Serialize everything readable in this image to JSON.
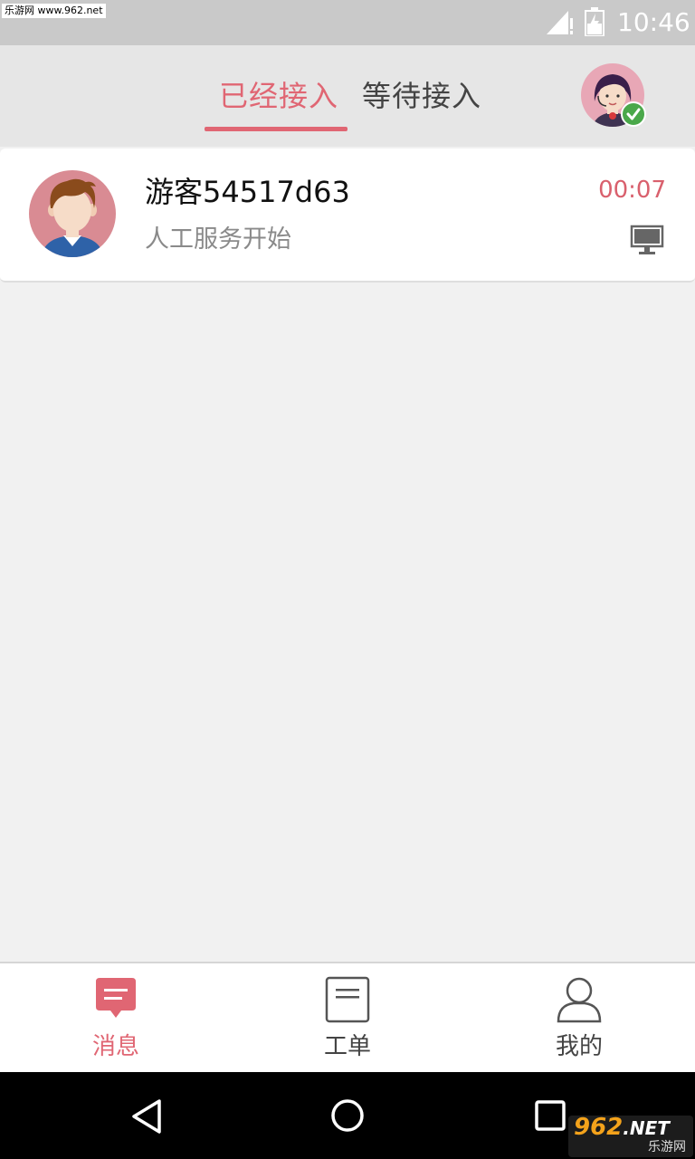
{
  "status_bar": {
    "watermark": "乐游网 www.962.net",
    "time": "10:46"
  },
  "header": {
    "tabs": [
      {
        "label": "已经接入",
        "active": true
      },
      {
        "label": "等待接入",
        "active": false
      }
    ],
    "agent_status": "online"
  },
  "conversations": [
    {
      "name": "游客54517d63",
      "status": "人工服务开始",
      "time": "00:07",
      "device": "desktop"
    }
  ],
  "bottom_nav": {
    "items": [
      {
        "label": "消息",
        "icon": "message-icon",
        "active": true
      },
      {
        "label": "工单",
        "icon": "document-icon",
        "active": false
      },
      {
        "label": "我的",
        "icon": "person-icon",
        "active": false
      }
    ]
  },
  "watermark_logo": {
    "top": "962",
    "top_suffix": ".NET",
    "bottom": "乐游网"
  },
  "colors": {
    "accent": "#e06673",
    "status_bar": "#c9c9c9",
    "header_bg": "#e6e6e6",
    "page_bg": "#f1f1f1"
  }
}
